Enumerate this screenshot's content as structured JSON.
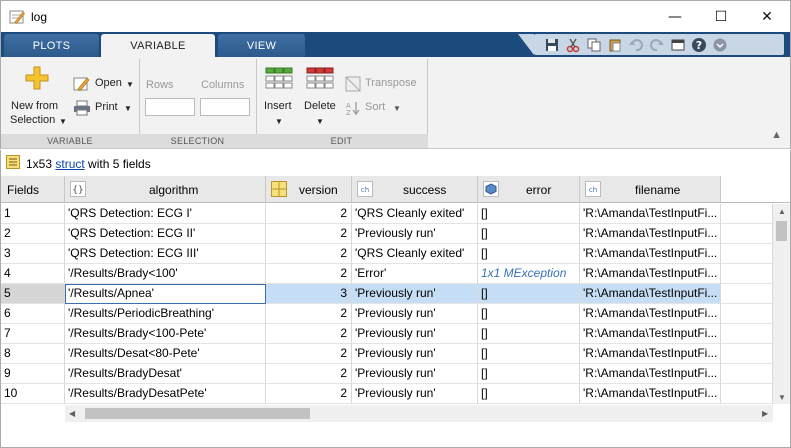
{
  "window": {
    "title": "log",
    "minimize_glyph": "—",
    "maximize_glyph": "☐",
    "close_glyph": "✕"
  },
  "tabs": [
    {
      "label": "PLOTS",
      "active": false
    },
    {
      "label": "VARIABLE",
      "active": true
    },
    {
      "label": "VIEW",
      "active": false
    }
  ],
  "quick_access_icons": [
    "save-icon",
    "cut-icon",
    "copy-icon",
    "paste-icon",
    "undo-icon",
    "redo-icon",
    "window-icon",
    "help-icon",
    "options-icon"
  ],
  "ribbon": {
    "variable": {
      "new_from_selection": "New from",
      "new_from_selection_line2": "Selection",
      "open": "Open",
      "print": "Print",
      "section_label": "VARIABLE"
    },
    "selection": {
      "rows_label": "Rows",
      "columns_label": "Columns",
      "rows_value": "",
      "columns_value": "",
      "section_label": "SELECTION"
    },
    "edit": {
      "insert": "Insert",
      "delete": "Delete",
      "transpose": "Transpose",
      "sort": "Sort",
      "section_label": "EDIT"
    }
  },
  "info": {
    "prefix": "1x53 ",
    "link": "struct",
    "suffix": " with 5 fields"
  },
  "table": {
    "corner": "Fields",
    "columns": [
      {
        "name": "algorithm",
        "icon": "cell-icon"
      },
      {
        "name": "version",
        "icon": "numeric-icon"
      },
      {
        "name": "success",
        "icon": "char-icon"
      },
      {
        "name": "error",
        "icon": "object-icon"
      },
      {
        "name": "filename",
        "icon": "char-icon"
      }
    ],
    "rows": [
      {
        "n": "1",
        "algorithm": "'QRS Detection: ECG I'",
        "version": "2",
        "success": "'QRS Cleanly exited'",
        "error": "[]",
        "filename": "'R:\\Amanda\\TestInputFi..."
      },
      {
        "n": "2",
        "algorithm": "'QRS Detection: ECG II'",
        "version": "2",
        "success": "'Previously run'",
        "error": "[]",
        "filename": "'R:\\Amanda\\TestInputFi..."
      },
      {
        "n": "3",
        "algorithm": "'QRS Detection: ECG III'",
        "version": "2",
        "success": "'QRS Cleanly exited'",
        "error": "[]",
        "filename": "'R:\\Amanda\\TestInputFi..."
      },
      {
        "n": "4",
        "algorithm": "'/Results/Brady<100'",
        "version": "2",
        "success": "'Error'",
        "error": "1x1 MException",
        "filename": "'R:\\Amanda\\TestInputFi..."
      },
      {
        "n": "5",
        "algorithm": "'/Results/Apnea'",
        "version": "3",
        "success": "'Previously run'",
        "error": "[]",
        "filename": "'R:\\Amanda\\TestInputFi..."
      },
      {
        "n": "6",
        "algorithm": "'/Results/PeriodicBreathing'",
        "version": "2",
        "success": "'Previously run'",
        "error": "[]",
        "filename": "'R:\\Amanda\\TestInputFi..."
      },
      {
        "n": "7",
        "algorithm": "'/Results/Brady<100-Pete'",
        "version": "2",
        "success": "'Previously run'",
        "error": "[]",
        "filename": "'R:\\Amanda\\TestInputFi..."
      },
      {
        "n": "8",
        "algorithm": "'/Results/Desat<80-Pete'",
        "version": "2",
        "success": "'Previously run'",
        "error": "[]",
        "filename": "'R:\\Amanda\\TestInputFi..."
      },
      {
        "n": "9",
        "algorithm": "'/Results/BradyDesat'",
        "version": "2",
        "success": "'Previously run'",
        "error": "[]",
        "filename": "'R:\\Amanda\\TestInputFi..."
      },
      {
        "n": "10",
        "algorithm": "'/Results/BradyDesatPete'",
        "version": "2",
        "success": "'Previously run'",
        "error": "[]",
        "filename": "'R:\\Amanda\\TestInputFi..."
      }
    ],
    "selected_row": "5",
    "selected_column": "algorithm"
  },
  "colors": {
    "tabstrip": "#1b4a7c",
    "ribbon": "#f2f2f2",
    "selection": "#c6def5",
    "link": "#0645ad"
  }
}
